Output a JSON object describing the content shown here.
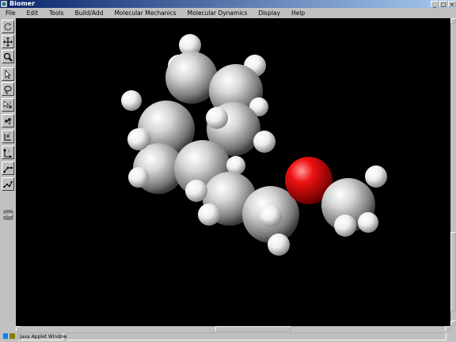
{
  "window": {
    "title": "Biomer",
    "controls": [
      "minimize-icon",
      "maximize-icon",
      "close-icon"
    ]
  },
  "menu": [
    {
      "label": "File"
    },
    {
      "label": "Edit"
    },
    {
      "label": "Tools"
    },
    {
      "label": "Build/Add"
    },
    {
      "label": "Molecular Mechanics"
    },
    {
      "label": "Molecular Dynamics"
    },
    {
      "label": "Display"
    },
    {
      "label": "Help"
    }
  ],
  "toolbar": {
    "tools": [
      {
        "icon": "rotate-icon"
      },
      {
        "icon": "move-icon"
      },
      {
        "icon": "zoom-icon"
      },
      {
        "icon": "select-arrow-icon"
      },
      {
        "icon": "lasso-icon"
      },
      {
        "icon": "select-atom-icon"
      },
      {
        "icon": "select-group-icon"
      },
      {
        "icon": "rotate-bond-icon"
      },
      {
        "icon": "measure-distance-icon"
      },
      {
        "icon": "measure-angle-icon"
      },
      {
        "icon": "measure-torsion-icon"
      },
      {
        "icon": "stop-icon",
        "label": "STOP"
      }
    ]
  },
  "molecule": {
    "colors": {
      "carbon": "#d8d8d8",
      "hydrogen": "#f4f4f4",
      "oxygen": "#e00000",
      "background": "#000000"
    }
  },
  "status": {
    "text": "Java Applet Window"
  }
}
